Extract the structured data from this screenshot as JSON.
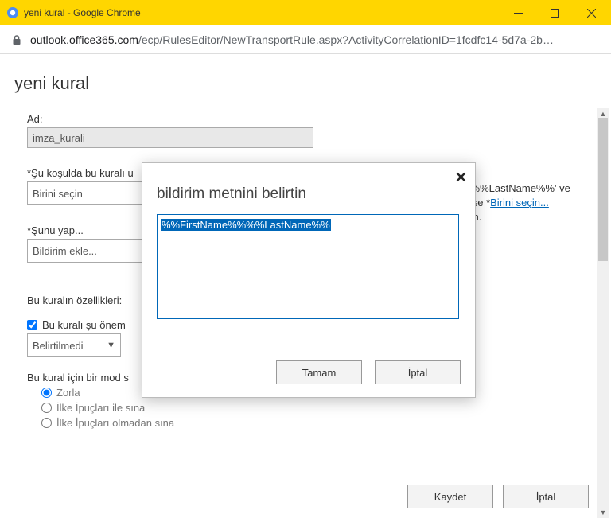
{
  "window": {
    "title": "yeni kural - Google Chrome",
    "url_host": "outlook.office365.com",
    "url_path": "/ecp/RulesEditor/NewTransportRule.aspx?ActivityCorrelationID=1fcdfc14-5d7a-2b…"
  },
  "page": {
    "title": "yeni kural",
    "name_label": "Ad:",
    "name_value": "imza_kurali",
    "condition_label": "*Şu koşulda bu kuralı u",
    "condition_value": "Birini seçin",
    "action_label": "*Şunu yap...",
    "action_value": "Bildirim ekle...",
    "properties_label": "Bu kuralın özellikleri:",
    "importance_check": "Bu kuralı şu önem",
    "importance_value": "Belirtilmedi",
    "mode_label": "Bu kural için bir mod s",
    "mode_enforce": "Zorla",
    "mode_hint1": "İlke İpuçları ile sına",
    "mode_hint2": "İlke İpuçları olmadan sına",
    "sideinfo_tail1": "%%%LastName%%' ve",
    "sideinfo_tail2_a": "ezse *",
    "sideinfo_link": "Birini seçin...",
    "sideinfo_tail3": "nün."
  },
  "footer": {
    "save": "Kaydet",
    "cancel": "İptal"
  },
  "modal": {
    "title": "bildirim metnini belirtin",
    "text_selected": "%%FirstName%%%%LastName%%",
    "ok": "Tamam",
    "cancel": "İptal"
  }
}
